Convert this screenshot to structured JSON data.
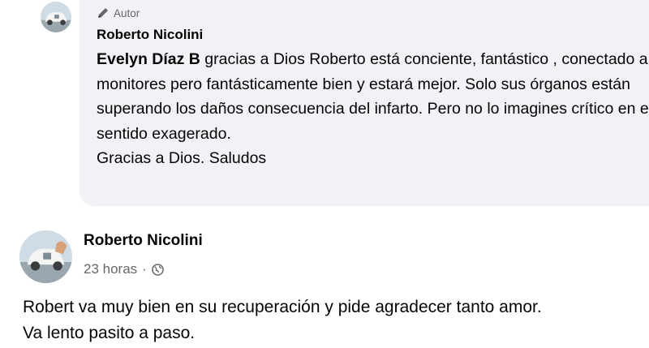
{
  "comment": {
    "badge_label": "Autor",
    "author_name": "Roberto Nicolini",
    "mention": "Evelyn Díaz B",
    "text_after_mention": " gracias a Dios Roberto está conciente, fantástico , conectado a monitores pero fantásticamente bien y estará mejor. Solo sus órganos están superando los daños consecuencia del infarto. Pero no lo imagines crítico en el sentido exagerado.",
    "closing_line": "Gracias a Dios. Saludos"
  },
  "post": {
    "author_name": "Roberto Nicolini",
    "time_label": "23 horas",
    "separator": "·",
    "body_line1": "Robert va muy bien en su recuperación y pide agradecer tanto amor.",
    "body_line2": "Va lento pasito a paso."
  },
  "icons": {
    "author_badge": "pencil-icon",
    "privacy": "globe-icon"
  }
}
